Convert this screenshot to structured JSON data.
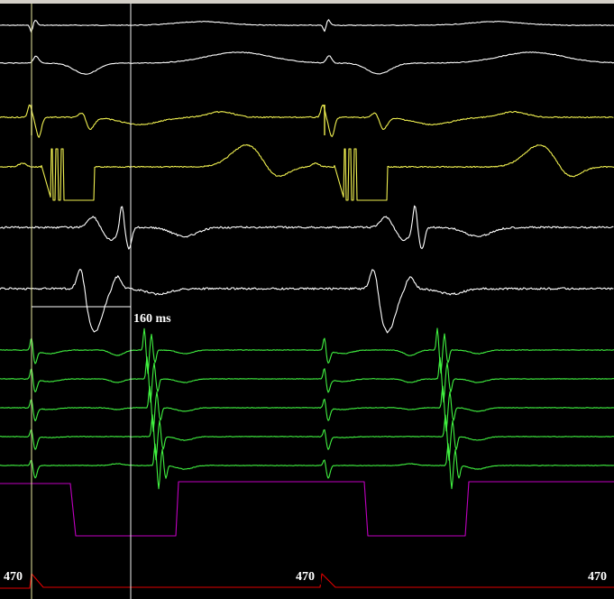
{
  "window": {
    "frame_color": "#d4d0c8"
  },
  "display": {
    "background": "#000000"
  },
  "caliper": {
    "label": "160 ms",
    "color": "#ffffff"
  },
  "stim_intervals": [
    {
      "label": "470"
    },
    {
      "label": "470"
    },
    {
      "label": "470"
    }
  ],
  "colors": {
    "surface_ecg": "#ffffff",
    "his_bundle": "#f0f050",
    "coronary_sinus": "#40f040",
    "stim_marker": "#c000c0",
    "stim_channel": "#e00000",
    "cursor_left": "#e8e8a0",
    "cursor_right": "#f0f0f0"
  },
  "channels": [
    {
      "name": "surface-ecg-1",
      "group": "surface_ecg"
    },
    {
      "name": "surface-ecg-2",
      "group": "surface_ecg"
    },
    {
      "name": "his-proximal",
      "group": "his_bundle"
    },
    {
      "name": "his-distal",
      "group": "his_bundle"
    },
    {
      "name": "surface-ecg-3",
      "group": "surface_ecg"
    },
    {
      "name": "surface-ecg-4",
      "group": "surface_ecg"
    },
    {
      "name": "cs-1",
      "group": "coronary_sinus"
    },
    {
      "name": "cs-2",
      "group": "coronary_sinus"
    },
    {
      "name": "cs-3",
      "group": "coronary_sinus"
    },
    {
      "name": "cs-4",
      "group": "coronary_sinus"
    },
    {
      "name": "cs-5",
      "group": "coronary_sinus"
    }
  ]
}
